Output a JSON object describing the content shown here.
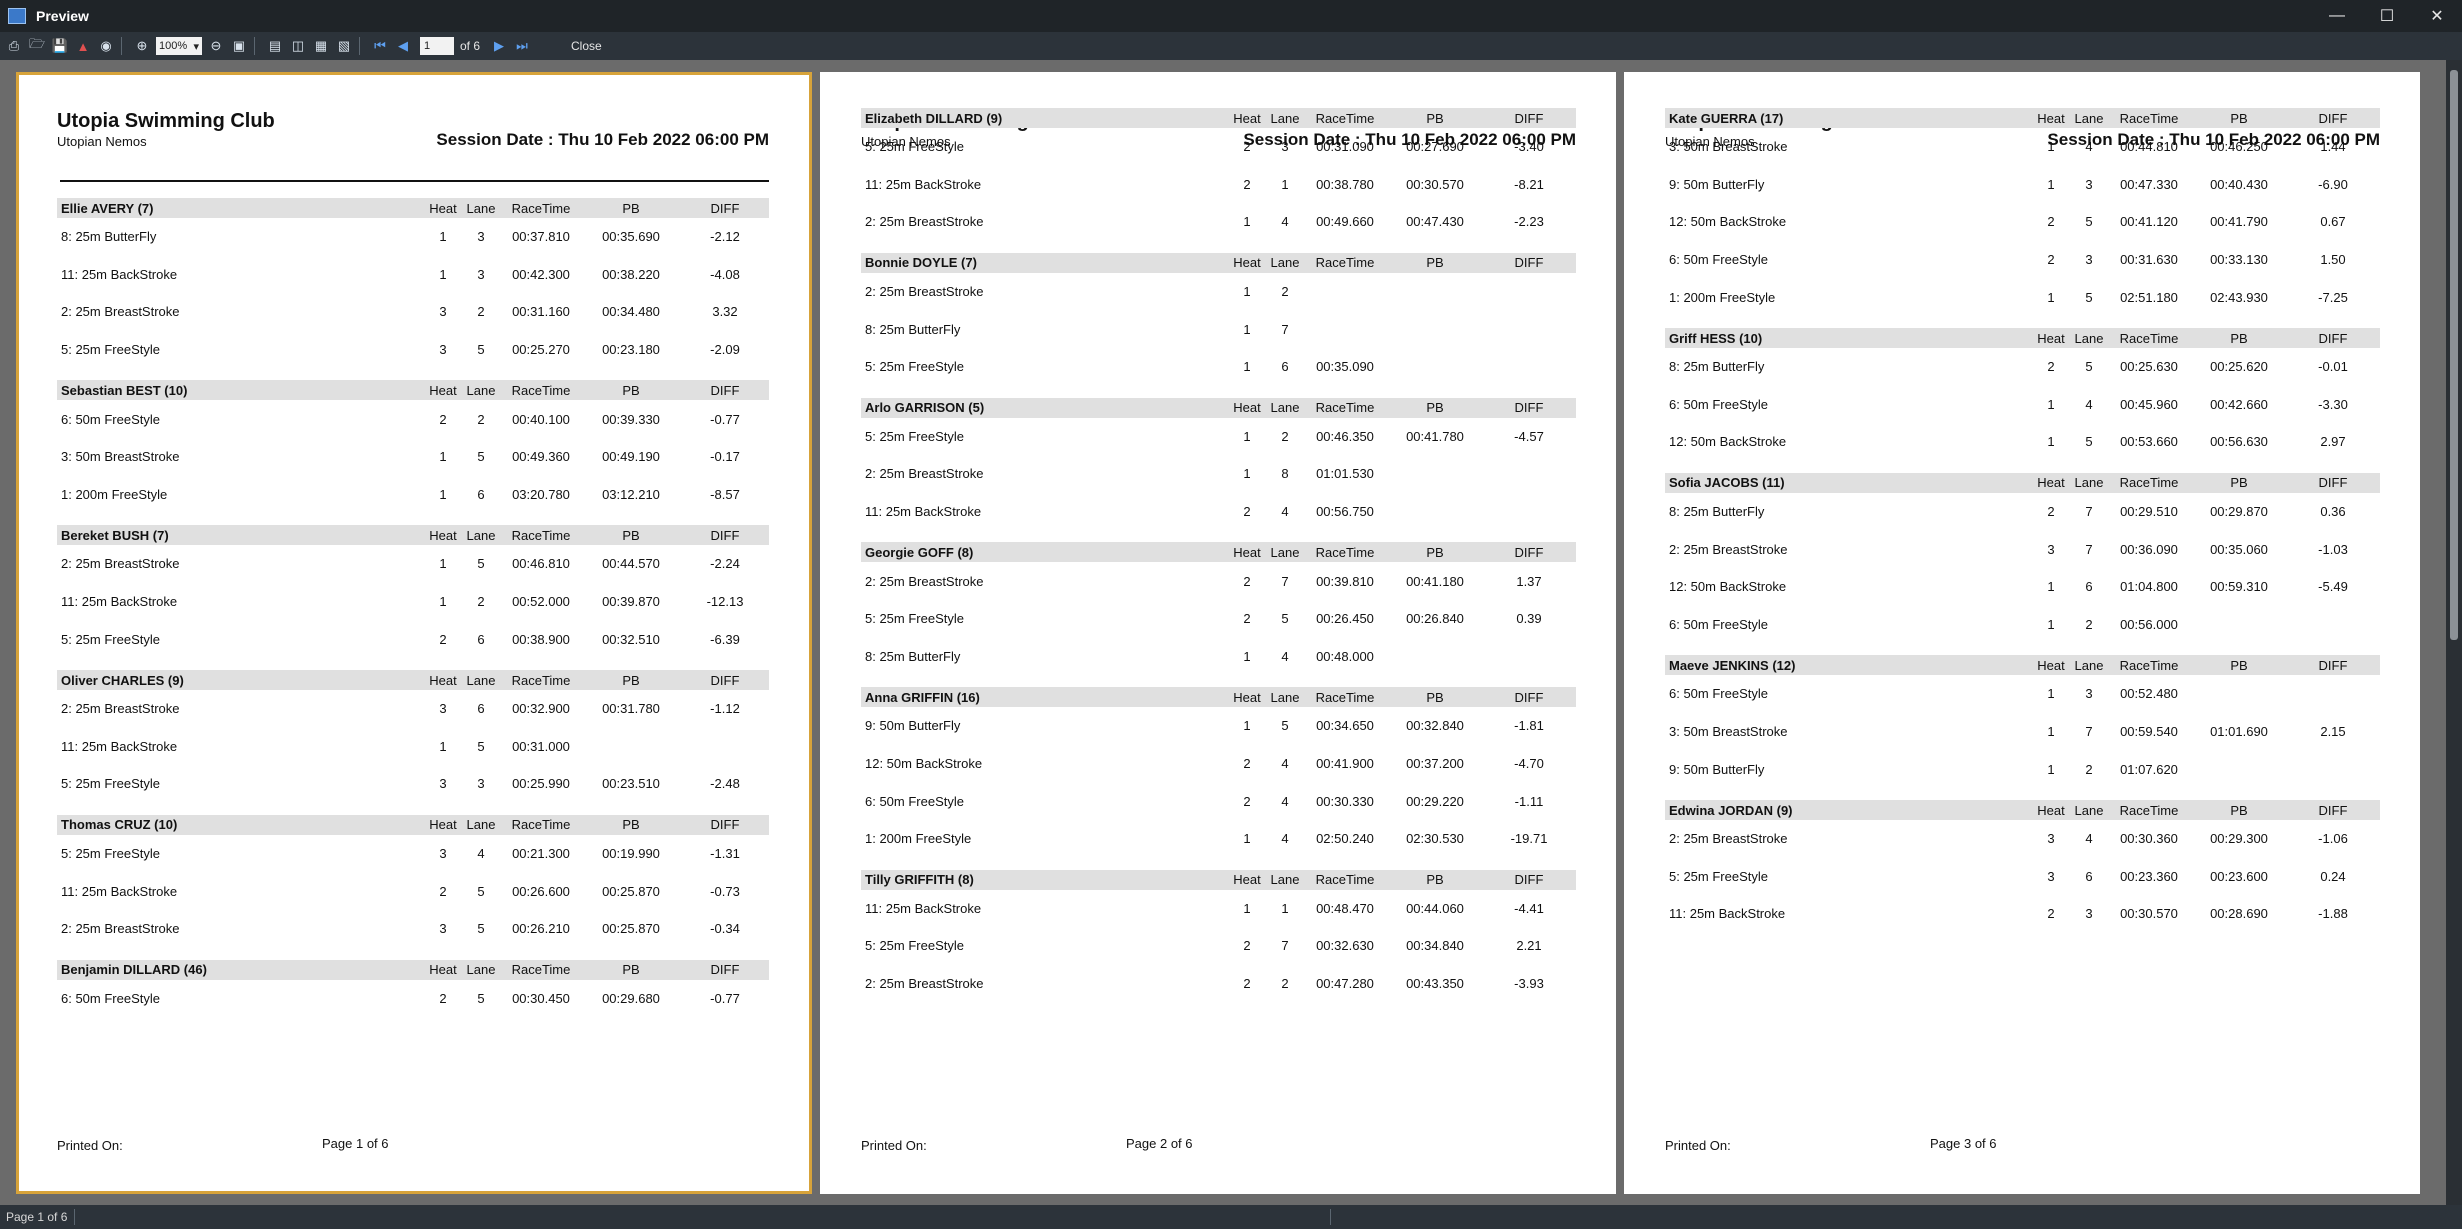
{
  "window": {
    "title": "Preview"
  },
  "toolbar": {
    "zoom": "100%",
    "page_input": "1",
    "page_of": "of 6",
    "close_label": "Close"
  },
  "status": {
    "text": "Page 1 of 6"
  },
  "report": {
    "club": "Utopia Swimming Club",
    "subtitle": "Utopian Nemos",
    "session": "Session Date : Thu 10 Feb 2022 06:00 PM",
    "printed_on": "Printed On:",
    "headers": {
      "heat": "Heat",
      "lane": "Lane",
      "racetime": "RaceTime",
      "pb": "PB",
      "diff": "DIFF"
    }
  },
  "pages": [
    {
      "page_label": "Page 1 of 6",
      "swimmers": [
        {
          "name": "Ellie AVERY (7)",
          "rows": [
            {
              "event": "8: 25m ButterFly",
              "heat": "1",
              "lane": "3",
              "race": "00:37.810",
              "pb": "00:35.690",
              "diff": "-2.12"
            },
            {
              "event": "11: 25m BackStroke",
              "heat": "1",
              "lane": "3",
              "race": "00:42.300",
              "pb": "00:38.220",
              "diff": "-4.08"
            },
            {
              "event": "2: 25m BreastStroke",
              "heat": "3",
              "lane": "2",
              "race": "00:31.160",
              "pb": "00:34.480",
              "diff": "3.32"
            },
            {
              "event": "5: 25m FreeStyle",
              "heat": "3",
              "lane": "5",
              "race": "00:25.270",
              "pb": "00:23.180",
              "diff": "-2.09"
            }
          ]
        },
        {
          "name": "Sebastian BEST (10)",
          "rows": [
            {
              "event": "6: 50m FreeStyle",
              "heat": "2",
              "lane": "2",
              "race": "00:40.100",
              "pb": "00:39.330",
              "diff": "-0.77"
            },
            {
              "event": "3: 50m BreastStroke",
              "heat": "1",
              "lane": "5",
              "race": "00:49.360",
              "pb": "00:49.190",
              "diff": "-0.17"
            },
            {
              "event": "1: 200m FreeStyle",
              "heat": "1",
              "lane": "6",
              "race": "03:20.780",
              "pb": "03:12.210",
              "diff": "-8.57"
            }
          ]
        },
        {
          "name": "Bereket BUSH (7)",
          "rows": [
            {
              "event": "2: 25m BreastStroke",
              "heat": "1",
              "lane": "5",
              "race": "00:46.810",
              "pb": "00:44.570",
              "diff": "-2.24"
            },
            {
              "event": "11: 25m BackStroke",
              "heat": "1",
              "lane": "2",
              "race": "00:52.000",
              "pb": "00:39.870",
              "diff": "-12.13"
            },
            {
              "event": "5: 25m FreeStyle",
              "heat": "2",
              "lane": "6",
              "race": "00:38.900",
              "pb": "00:32.510",
              "diff": "-6.39"
            }
          ]
        },
        {
          "name": "Oliver CHARLES (9)",
          "rows": [
            {
              "event": "2: 25m BreastStroke",
              "heat": "3",
              "lane": "6",
              "race": "00:32.900",
              "pb": "00:31.780",
              "diff": "-1.12"
            },
            {
              "event": "11: 25m BackStroke",
              "heat": "1",
              "lane": "5",
              "race": "00:31.000",
              "pb": "",
              "diff": ""
            },
            {
              "event": "5: 25m FreeStyle",
              "heat": "3",
              "lane": "3",
              "race": "00:25.990",
              "pb": "00:23.510",
              "diff": "-2.48"
            }
          ]
        },
        {
          "name": "Thomas CRUZ (10)",
          "rows": [
            {
              "event": "5: 25m FreeStyle",
              "heat": "3",
              "lane": "4",
              "race": "00:21.300",
              "pb": "00:19.990",
              "diff": "-1.31"
            },
            {
              "event": "11: 25m BackStroke",
              "heat": "2",
              "lane": "5",
              "race": "00:26.600",
              "pb": "00:25.870",
              "diff": "-0.73"
            },
            {
              "event": "2: 25m BreastStroke",
              "heat": "3",
              "lane": "5",
              "race": "00:26.210",
              "pb": "00:25.870",
              "diff": "-0.34"
            }
          ]
        },
        {
          "name": "Benjamin DILLARD (46)",
          "rows": [
            {
              "event": "6: 50m FreeStyle",
              "heat": "2",
              "lane": "5",
              "race": "00:30.450",
              "pb": "00:29.680",
              "diff": "-0.77"
            }
          ]
        }
      ]
    },
    {
      "page_label": "Page 2 of 6",
      "swimmers": [
        {
          "name": "Elizabeth DILLARD (9)",
          "rows": [
            {
              "event": "5: 25m FreeStyle",
              "heat": "2",
              "lane": "3",
              "race": "00:31.090",
              "pb": "00:27.690",
              "diff": "-3.40"
            },
            {
              "event": "11: 25m BackStroke",
              "heat": "2",
              "lane": "1",
              "race": "00:38.780",
              "pb": "00:30.570",
              "diff": "-8.21"
            },
            {
              "event": "2: 25m BreastStroke",
              "heat": "1",
              "lane": "4",
              "race": "00:49.660",
              "pb": "00:47.430",
              "diff": "-2.23"
            }
          ]
        },
        {
          "name": "Bonnie DOYLE (7)",
          "rows": [
            {
              "event": "2: 25m BreastStroke",
              "heat": "1",
              "lane": "2",
              "race": "",
              "pb": "",
              "diff": ""
            },
            {
              "event": "8: 25m ButterFly",
              "heat": "1",
              "lane": "7",
              "race": "",
              "pb": "",
              "diff": ""
            },
            {
              "event": "5: 25m FreeStyle",
              "heat": "1",
              "lane": "6",
              "race": "00:35.090",
              "pb": "",
              "diff": ""
            }
          ]
        },
        {
          "name": "Arlo GARRISON (5)",
          "rows": [
            {
              "event": "5: 25m FreeStyle",
              "heat": "1",
              "lane": "2",
              "race": "00:46.350",
              "pb": "00:41.780",
              "diff": "-4.57"
            },
            {
              "event": "2: 25m BreastStroke",
              "heat": "1",
              "lane": "8",
              "race": "01:01.530",
              "pb": "",
              "diff": ""
            },
            {
              "event": "11: 25m BackStroke",
              "heat": "2",
              "lane": "4",
              "race": "00:56.750",
              "pb": "",
              "diff": ""
            }
          ]
        },
        {
          "name": "Georgie GOFF (8)",
          "rows": [
            {
              "event": "2: 25m BreastStroke",
              "heat": "2",
              "lane": "7",
              "race": "00:39.810",
              "pb": "00:41.180",
              "diff": "1.37"
            },
            {
              "event": "5: 25m FreeStyle",
              "heat": "2",
              "lane": "5",
              "race": "00:26.450",
              "pb": "00:26.840",
              "diff": "0.39"
            },
            {
              "event": "8: 25m ButterFly",
              "heat": "1",
              "lane": "4",
              "race": "00:48.000",
              "pb": "",
              "diff": ""
            }
          ]
        },
        {
          "name": "Anna GRIFFIN (16)",
          "rows": [
            {
              "event": "9: 50m ButterFly",
              "heat": "1",
              "lane": "5",
              "race": "00:34.650",
              "pb": "00:32.840",
              "diff": "-1.81"
            },
            {
              "event": "12: 50m BackStroke",
              "heat": "2",
              "lane": "4",
              "race": "00:41.900",
              "pb": "00:37.200",
              "diff": "-4.70"
            },
            {
              "event": "6: 50m FreeStyle",
              "heat": "2",
              "lane": "4",
              "race": "00:30.330",
              "pb": "00:29.220",
              "diff": "-1.11"
            },
            {
              "event": "1: 200m FreeStyle",
              "heat": "1",
              "lane": "4",
              "race": "02:50.240",
              "pb": "02:30.530",
              "diff": "-19.71"
            }
          ]
        },
        {
          "name": "Tilly GRIFFITH (8)",
          "rows": [
            {
              "event": "11: 25m BackStroke",
              "heat": "1",
              "lane": "1",
              "race": "00:48.470",
              "pb": "00:44.060",
              "diff": "-4.41"
            },
            {
              "event": "5: 25m FreeStyle",
              "heat": "2",
              "lane": "7",
              "race": "00:32.630",
              "pb": "00:34.840",
              "diff": "2.21"
            },
            {
              "event": "2: 25m BreastStroke",
              "heat": "2",
              "lane": "2",
              "race": "00:47.280",
              "pb": "00:43.350",
              "diff": "-3.93"
            }
          ]
        }
      ]
    },
    {
      "page_label": "Page 3 of 6",
      "swimmers": [
        {
          "name": "Kate GUERRA (17)",
          "rows": [
            {
              "event": "3: 50m BreastStroke",
              "heat": "1",
              "lane": "4",
              "race": "00:44.810",
              "pb": "00:46.250",
              "diff": "1.44"
            },
            {
              "event": "9: 50m ButterFly",
              "heat": "1",
              "lane": "3",
              "race": "00:47.330",
              "pb": "00:40.430",
              "diff": "-6.90"
            },
            {
              "event": "12: 50m BackStroke",
              "heat": "2",
              "lane": "5",
              "race": "00:41.120",
              "pb": "00:41.790",
              "diff": "0.67"
            },
            {
              "event": "6: 50m FreeStyle",
              "heat": "2",
              "lane": "3",
              "race": "00:31.630",
              "pb": "00:33.130",
              "diff": "1.50"
            },
            {
              "event": "1: 200m FreeStyle",
              "heat": "1",
              "lane": "5",
              "race": "02:51.180",
              "pb": "02:43.930",
              "diff": "-7.25"
            }
          ]
        },
        {
          "name": "Griff HESS (10)",
          "rows": [
            {
              "event": "8: 25m ButterFly",
              "heat": "2",
              "lane": "5",
              "race": "00:25.630",
              "pb": "00:25.620",
              "diff": "-0.01"
            },
            {
              "event": "6: 50m FreeStyle",
              "heat": "1",
              "lane": "4",
              "race": "00:45.960",
              "pb": "00:42.660",
              "diff": "-3.30"
            },
            {
              "event": "12: 50m BackStroke",
              "heat": "1",
              "lane": "5",
              "race": "00:53.660",
              "pb": "00:56.630",
              "diff": "2.97"
            }
          ]
        },
        {
          "name": "Sofia JACOBS (11)",
          "rows": [
            {
              "event": "8: 25m ButterFly",
              "heat": "2",
              "lane": "7",
              "race": "00:29.510",
              "pb": "00:29.870",
              "diff": "0.36"
            },
            {
              "event": "2: 25m BreastStroke",
              "heat": "3",
              "lane": "7",
              "race": "00:36.090",
              "pb": "00:35.060",
              "diff": "-1.03"
            },
            {
              "event": "12: 50m BackStroke",
              "heat": "1",
              "lane": "6",
              "race": "01:04.800",
              "pb": "00:59.310",
              "diff": "-5.49"
            },
            {
              "event": "6: 50m FreeStyle",
              "heat": "1",
              "lane": "2",
              "race": "00:56.000",
              "pb": "",
              "diff": ""
            }
          ]
        },
        {
          "name": "Maeve JENKINS (12)",
          "rows": [
            {
              "event": "6: 50m FreeStyle",
              "heat": "1",
              "lane": "3",
              "race": "00:52.480",
              "pb": "",
              "diff": ""
            },
            {
              "event": "3: 50m BreastStroke",
              "heat": "1",
              "lane": "7",
              "race": "00:59.540",
              "pb": "01:01.690",
              "diff": "2.15"
            },
            {
              "event": "9: 50m ButterFly",
              "heat": "1",
              "lane": "2",
              "race": "01:07.620",
              "pb": "",
              "diff": ""
            }
          ]
        },
        {
          "name": "Edwina JORDAN (9)",
          "rows": [
            {
              "event": "2: 25m BreastStroke",
              "heat": "3",
              "lane": "4",
              "race": "00:30.360",
              "pb": "00:29.300",
              "diff": "-1.06"
            },
            {
              "event": "5: 25m FreeStyle",
              "heat": "3",
              "lane": "6",
              "race": "00:23.360",
              "pb": "00:23.600",
              "diff": "0.24"
            },
            {
              "event": "11: 25m BackStroke",
              "heat": "2",
              "lane": "3",
              "race": "00:30.570",
              "pb": "00:28.690",
              "diff": "-1.88"
            }
          ]
        }
      ]
    }
  ]
}
